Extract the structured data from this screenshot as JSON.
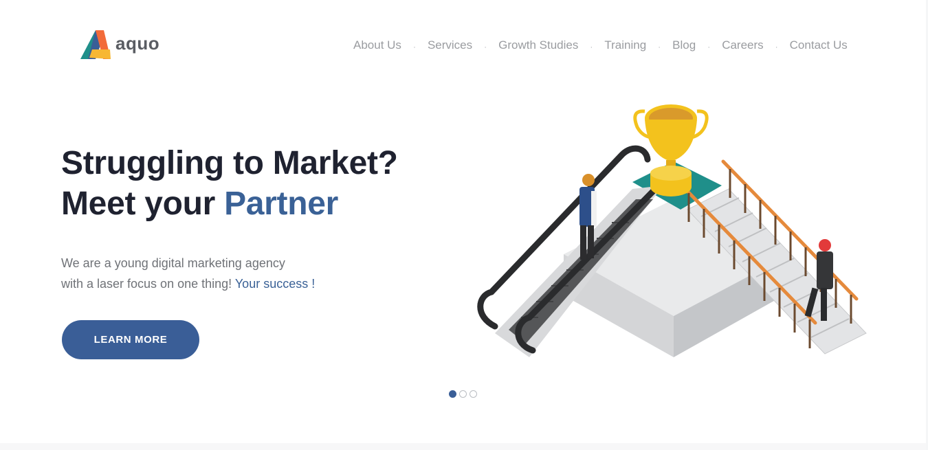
{
  "brand": {
    "name": "aquo",
    "colors": {
      "orange": "#f26b3a",
      "yellow": "#f7b733",
      "blue": "#3a5e97",
      "teal": "#1f8f8a"
    }
  },
  "nav": {
    "items": [
      {
        "label": "About Us"
      },
      {
        "label": "Services"
      },
      {
        "label": "Growth Studies"
      },
      {
        "label": "Training"
      },
      {
        "label": "Blog"
      },
      {
        "label": "Careers"
      },
      {
        "label": "Contact Us"
      }
    ],
    "separator": "·"
  },
  "hero": {
    "title_line1": "Struggling to Market?",
    "title_line2_prefix": "Meet your ",
    "title_line2_accent": "Partner",
    "text_line1": "We are a young digital marketing agency",
    "text_line2_prefix": "with a laser focus on one thing! ",
    "text_line2_accent": "Your success !",
    "cta_label": "LEARN MORE",
    "illustration_icon": "trophy-stairs-illustration"
  },
  "carousel": {
    "slides": 3,
    "active_index": 0
  },
  "theme": {
    "accent": "#3a5e97",
    "title_color": "#1f2230",
    "nav_color": "#9a9ca0"
  }
}
